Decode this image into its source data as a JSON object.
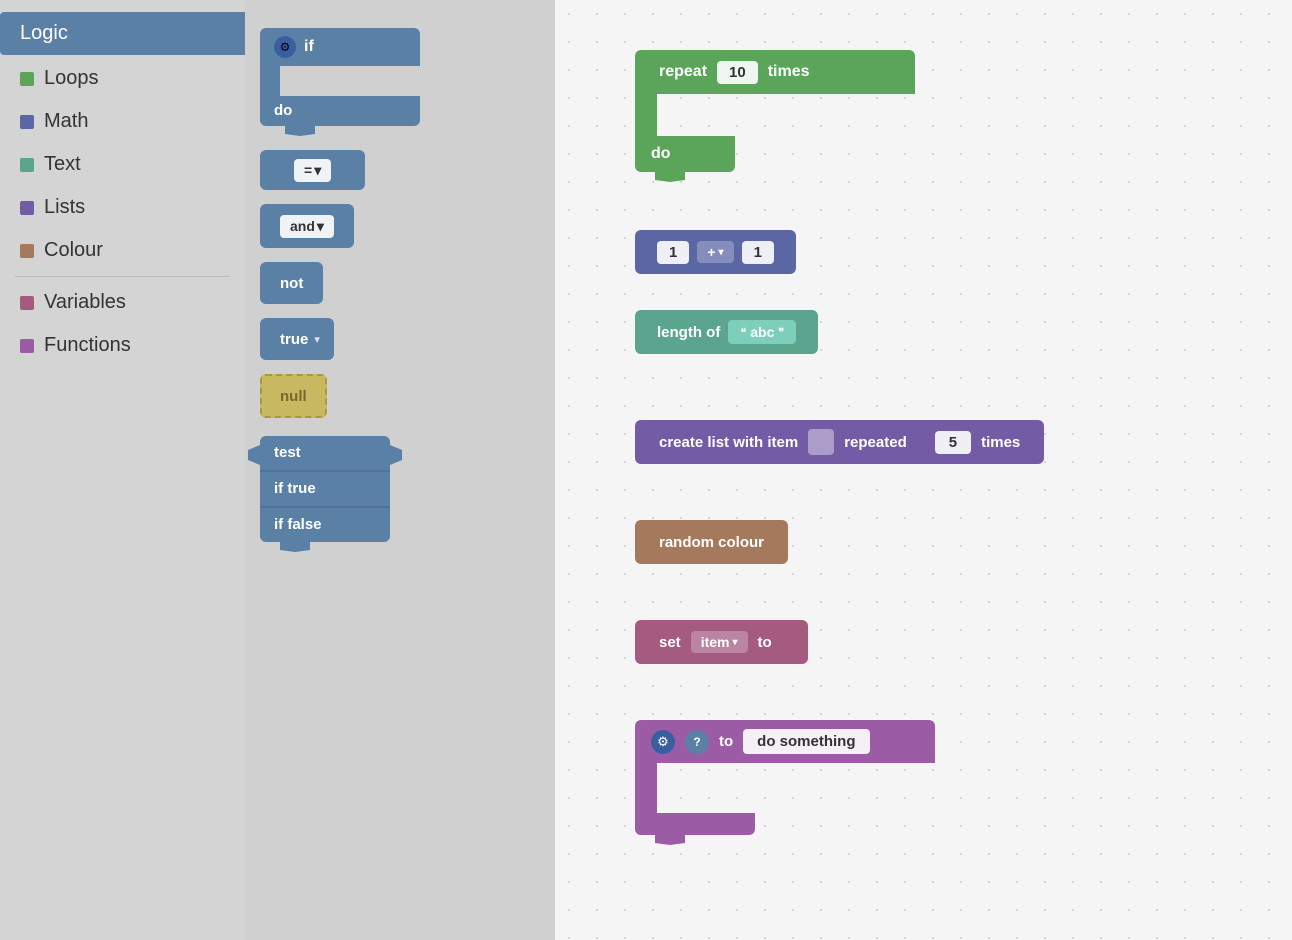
{
  "sidebar": {
    "items": [
      {
        "label": "Logic",
        "color": "#5b80a5",
        "active": true
      },
      {
        "label": "Loops",
        "color": "#5ba55b",
        "active": false
      },
      {
        "label": "Math",
        "color": "#5b67a5",
        "active": false
      },
      {
        "label": "Text",
        "color": "#5ba58e",
        "active": false
      },
      {
        "label": "Lists",
        "color": "#745ba5",
        "active": false
      },
      {
        "label": "Colour",
        "color": "#a5795b",
        "active": false
      },
      {
        "label": "Variables",
        "color": "#a55b80",
        "active": false
      },
      {
        "label": "Functions",
        "color": "#9b5ba5",
        "active": false
      }
    ]
  },
  "blocks_panel": {
    "if_label": "if",
    "do_label": "do",
    "eq_label": "=",
    "and_label": "and",
    "not_label": "not",
    "true_label": "true",
    "null_label": "null",
    "test_label": "test",
    "if_true_label": "if true",
    "if_false_label": "if false"
  },
  "workspace": {
    "repeat_block": {
      "label": "repeat",
      "value": "10",
      "times_label": "times",
      "do_label": "do"
    },
    "math_block": {
      "val1": "1",
      "op": "+",
      "val2": "1"
    },
    "text_block": {
      "length_label": "length of",
      "value": "abc"
    },
    "list_block": {
      "label": "create list with item",
      "repeated_label": "repeated",
      "value": "5",
      "times_label": "times"
    },
    "colour_block": {
      "label": "random colour"
    },
    "variable_block": {
      "set_label": "set",
      "var_name": "item",
      "to_label": "to"
    },
    "function_block": {
      "to_label": "to",
      "name": "do something"
    }
  }
}
